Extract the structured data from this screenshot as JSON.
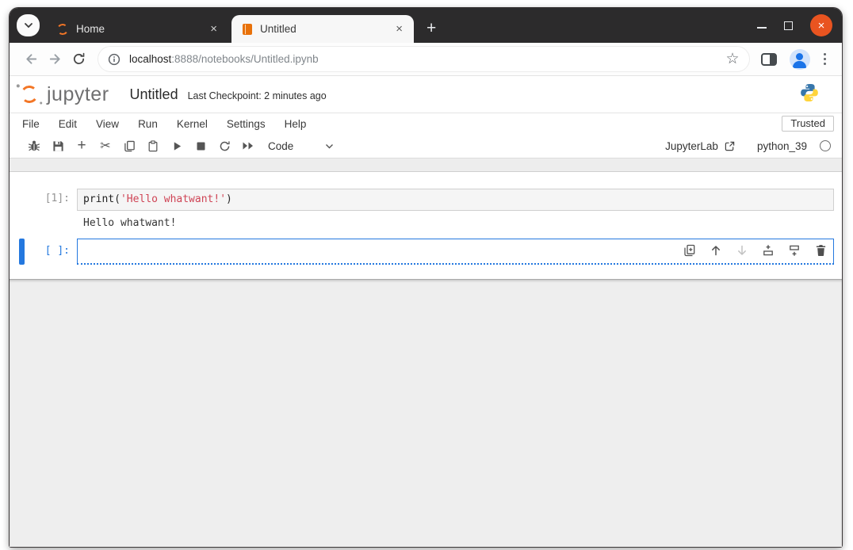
{
  "browser": {
    "tabs": [
      {
        "label": "Home",
        "active": false
      },
      {
        "label": "Untitled",
        "active": true
      }
    ],
    "address": {
      "host": "localhost",
      "path": ":8888/notebooks/Untitled.ipynb"
    }
  },
  "icons": {
    "close": "×",
    "new_tab": "+",
    "star": "☆",
    "run": "▶",
    "stop": "■",
    "cut": "✂",
    "add_cell": "+"
  },
  "header": {
    "brand": "jupyter",
    "title": "Untitled",
    "checkpoint": "Last Checkpoint: 2 minutes ago"
  },
  "menubar": {
    "items": [
      "File",
      "Edit",
      "View",
      "Run",
      "Kernel",
      "Settings",
      "Help"
    ],
    "trusted_label": "Trusted"
  },
  "toolbar": {
    "cell_type_selected": "Code",
    "jupyterlab_label": "JupyterLab",
    "kernel_label": "python_39"
  },
  "notebook": {
    "cells": [
      {
        "prompt": "[1]:",
        "code_tokens": [
          {
            "text": "print",
            "type": "builtin"
          },
          {
            "text": "(",
            "type": "plain"
          },
          {
            "text": "'Hello whatwant!'",
            "type": "string"
          },
          {
            "text": ")",
            "type": "plain"
          }
        ],
        "output": "Hello whatwant!"
      },
      {
        "prompt": "[ ]:",
        "code": ""
      }
    ]
  },
  "colors": {
    "tab_bar_bg": "#2c2b2c",
    "jupyter_orange": "#f37626",
    "ubuntu_close_orange": "#e95420",
    "accent_blue": "#2478df",
    "code_string_red": "#cf4455"
  }
}
